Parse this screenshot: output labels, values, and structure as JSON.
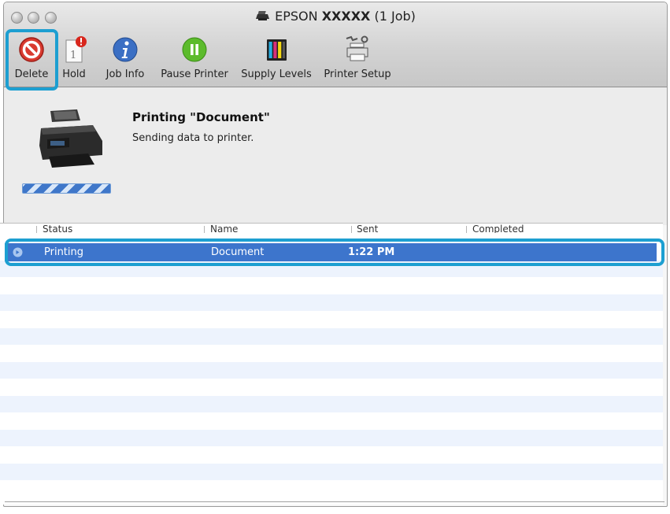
{
  "window": {
    "title_prefix": "EPSON",
    "title_model": "XXXXX",
    "title_jobs": "(1 Job)"
  },
  "toolbar": {
    "items": [
      {
        "id": "delete",
        "label": "Delete",
        "icon": "delete-icon"
      },
      {
        "id": "hold",
        "label": "Hold",
        "icon": "hold-icon"
      },
      {
        "id": "job-info",
        "label": "Job Info",
        "icon": "info-icon"
      },
      {
        "id": "pause-printer",
        "label": "Pause Printer",
        "icon": "pause-icon"
      },
      {
        "id": "supply-levels",
        "label": "Supply Levels",
        "icon": "ink-levels-icon"
      },
      {
        "id": "printer-setup",
        "label": "Printer Setup",
        "icon": "printer-setup-icon"
      }
    ]
  },
  "status_panel": {
    "job_title": "Printing \"Document\"",
    "status_text": "Sending data to printer."
  },
  "job_table": {
    "columns": [
      "Status",
      "Name",
      "Sent",
      "Completed"
    ],
    "rows": [
      {
        "status": "Printing",
        "name": "Document",
        "sent": "1:22 PM",
        "completed": ""
      }
    ]
  },
  "colors": {
    "highlight": "#1d9fd1",
    "selection": "#3d75cc",
    "stripe": "#edf3fd"
  }
}
